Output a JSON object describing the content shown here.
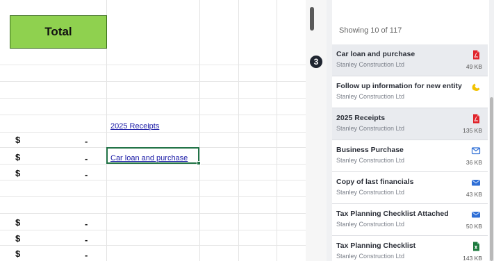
{
  "spreadsheet": {
    "total_label": "Total",
    "currency_symbol": "$",
    "dash": "-",
    "link_2025_receipts": "2025 Receipts",
    "link_car_loan": "Car loan and purchase"
  },
  "step_badge": "3",
  "panel": {
    "showing_text": "Showing 10 of 117",
    "items": [
      {
        "title": "Car loan and purchase",
        "company": "Stanley Construction Ltd",
        "size": "49 KB",
        "icon": "pdf-icon"
      },
      {
        "title": "Follow up information for new entity",
        "company": "Stanley Construction Ltd",
        "size": "",
        "icon": "phone-icon"
      },
      {
        "title": "2025 Receipts",
        "company": "Stanley Construction Ltd",
        "size": "135 KB",
        "icon": "pdf-icon"
      },
      {
        "title": "Business Purchase",
        "company": "Stanley Construction Ltd",
        "size": "36 KB",
        "icon": "email-outline-icon"
      },
      {
        "title": "Copy of last financials",
        "company": "Stanley Construction Ltd",
        "size": "43 KB",
        "icon": "email-icon"
      },
      {
        "title": "Tax Planning Checklist Attached",
        "company": "Stanley Construction Ltd",
        "size": "50 KB",
        "icon": "email-icon"
      },
      {
        "title": "Tax Planning Checklist",
        "company": "Stanley Construction Ltd",
        "size": "143 KB",
        "icon": "excel-icon"
      }
    ]
  },
  "colors": {
    "total_fill": "#8fd14f",
    "link": "#1a1aa6",
    "selection": "#217346",
    "pdf": "#e0242b",
    "email": "#2f6fd6",
    "phone": "#f2c200",
    "excel": "#1d7a3e"
  }
}
